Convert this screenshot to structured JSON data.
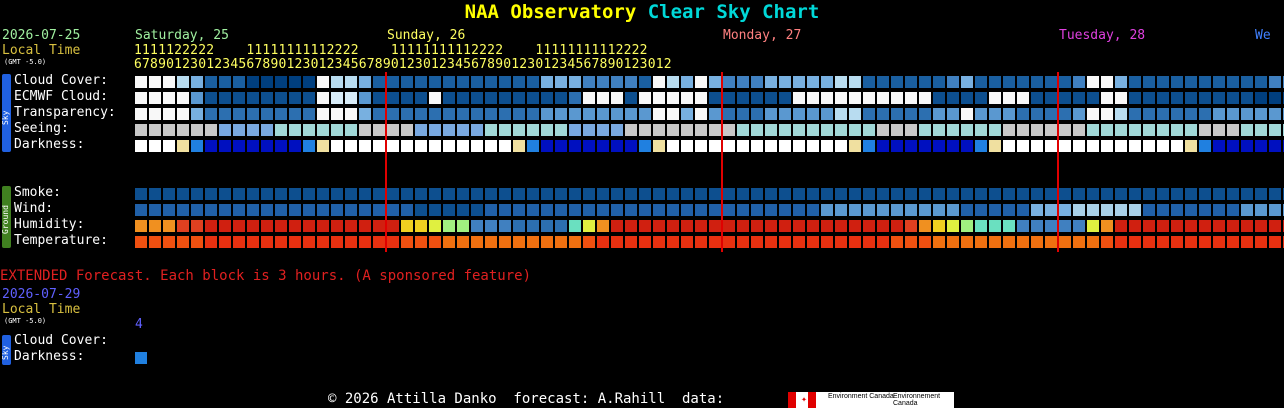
{
  "title_part1": "NAA Observatory",
  "title_part2": "Clear Sky Chart",
  "date": "2026-07-25",
  "local_time_label": "Local Time",
  "gmt_label": "(GMT -5.0)",
  "days": [
    {
      "label": "Saturday, 25",
      "color": "#a0f0a0"
    },
    {
      "label": "Sunday, 26",
      "color": "#ffff60"
    },
    {
      "label": "Monday, 27",
      "color": "#ff8080"
    },
    {
      "label": "Tuesday, 28",
      "color": "#e040e0"
    },
    {
      "label": "We",
      "color": "#4080ff"
    }
  ],
  "hour_row_top": "1111122222    11111111112222    11111111112222    11111111112222",
  "hour_row_bottom": "6789012301234567890123012345678901230123456789012301234567890123012",
  "sky_group_label": "Sky",
  "ground_group_label": "Ground",
  "rows": {
    "cloud": "Cloud Cover:",
    "ecmwf": "ECMWF Cloud:",
    "transparency": "Transparency:",
    "seeing": "Seeing:",
    "darkness": "Darkness:",
    "smoke": "Smoke:",
    "wind": "Wind:",
    "humidity": "Humidity:",
    "temperature": "Temperature:"
  },
  "extended_note": "EXTENDED Forecast. Each block is 3 hours. (A sponsored feature)",
  "ext_date": "2026-07-29",
  "ext_local_time": "Local Time",
  "ext_gmt": "(GMT -5.0)",
  "ext_hour": "4",
  "ext_rows": {
    "cloud": "Cloud Cover:",
    "darkness": "Darkness:"
  },
  "footer_text": "© 2026 Attilla Danko  forecast: A.Rahill  data:",
  "env_canada_en": "Environment Canada",
  "env_canada_fr": "Environnement Canada",
  "colors": {
    "midnight_line": "#e00000",
    "gold_label": "#d8c040",
    "extended_red": "#e02020",
    "sky_tab": "#2060e0",
    "ground_tab": "#408020"
  },
  "chart_data": {
    "type": "heatmap",
    "first_hour": 6,
    "midnight_columns": [
      18,
      42,
      66
    ],
    "cloud_cover": [
      6,
      5,
      5,
      4,
      3,
      1,
      1,
      1,
      0,
      0,
      0,
      0,
      0,
      5,
      4,
      4,
      3,
      1,
      1,
      1,
      1,
      1,
      1,
      1,
      1,
      1,
      1,
      1,
      1,
      3,
      3,
      3,
      2,
      2,
      2,
      2,
      1,
      5,
      4,
      3,
      5,
      3,
      2,
      2,
      2,
      3,
      3,
      3,
      3,
      3,
      4,
      4,
      1,
      1,
      1,
      1,
      1,
      1,
      2,
      3,
      1,
      1,
      1,
      1,
      1,
      1,
      1,
      2,
      5,
      5,
      3,
      1,
      1,
      1,
      1,
      1,
      1,
      1,
      1,
      1,
      1,
      2,
      2,
      1,
      1,
      1,
      1,
      1,
      1,
      1,
      1,
      1,
      1,
      1,
      1,
      1,
      1,
      1,
      1,
      1,
      1,
      1,
      1,
      1,
      1,
      1
    ],
    "ecmwf_cloud": [
      10,
      10,
      10,
      10,
      5,
      1,
      1,
      1,
      1,
      1,
      1,
      1,
      1,
      10,
      9,
      9,
      5,
      1,
      1,
      1,
      1,
      10,
      1,
      1,
      1,
      1,
      1,
      1,
      1,
      1,
      1,
      3,
      10,
      10,
      10,
      1,
      10,
      10,
      10,
      10,
      10,
      1,
      1,
      1,
      1,
      1,
      1,
      10,
      10,
      10,
      10,
      10,
      10,
      10,
      10,
      10,
      10,
      1,
      1,
      1,
      1,
      10,
      10,
      10,
      1,
      1,
      1,
      1,
      1,
      10,
      10,
      1,
      1,
      1,
      1,
      1,
      1,
      1,
      1,
      1,
      0,
      0,
      0,
      0,
      0,
      0,
      0,
      0,
      0,
      0,
      0,
      0,
      0,
      0,
      0,
      0,
      0,
      2,
      2,
      2,
      2,
      2,
      1,
      1,
      1,
      1
    ],
    "transparency": [
      10,
      10,
      10,
      10,
      6,
      3,
      3,
      3,
      3,
      3,
      3,
      3,
      3,
      10,
      10,
      10,
      6,
      3,
      3,
      3,
      3,
      3,
      3,
      3,
      3,
      3,
      3,
      3,
      3,
      5,
      5,
      5,
      5,
      5,
      5,
      5,
      5,
      10,
      10,
      6,
      10,
      5,
      3,
      3,
      3,
      5,
      5,
      5,
      5,
      5,
      8,
      8,
      3,
      3,
      3,
      3,
      3,
      5,
      5,
      10,
      5,
      5,
      5,
      3,
      3,
      3,
      3,
      5,
      10,
      10,
      8,
      3,
      3,
      3,
      3,
      3,
      3,
      5,
      5,
      5,
      5,
      5,
      5,
      5,
      5,
      5,
      3,
      3,
      3,
      3,
      3,
      3,
      3,
      3,
      3,
      3,
      3,
      3,
      3,
      3,
      3,
      5,
      5,
      5,
      5,
      5
    ],
    "seeing": [
      10,
      10,
      10,
      10,
      10,
      10,
      4,
      4,
      4,
      4,
      8,
      8,
      8,
      8,
      8,
      8,
      10,
      10,
      10,
      10,
      4,
      4,
      4,
      4,
      4,
      8,
      8,
      8,
      8,
      8,
      8,
      4,
      4,
      4,
      4,
      10,
      10,
      10,
      10,
      10,
      10,
      10,
      10,
      8,
      8,
      8,
      8,
      8,
      8,
      8,
      8,
      8,
      8,
      10,
      10,
      10,
      8,
      8,
      8,
      8,
      8,
      8,
      10,
      10,
      10,
      10,
      10,
      10,
      8,
      8,
      8,
      8,
      8,
      8,
      8,
      8,
      10,
      10,
      10,
      8,
      8,
      8,
      8,
      8,
      8,
      8,
      8,
      8,
      8,
      8,
      8,
      8,
      8,
      8,
      8,
      8,
      8,
      8,
      8,
      8,
      8,
      8,
      8,
      8,
      8,
      8
    ],
    "darkness": [
      0.0,
      0.0,
      0.0,
      0.2,
      0.6,
      1.0,
      1.0,
      1.0,
      1.0,
      1.0,
      1.0,
      1.0,
      0.6,
      0.2,
      0.0,
      0.0,
      0.0,
      0.0,
      0.0,
      0.0,
      0.0,
      0.0,
      0.0,
      0.0,
      0.0,
      0.0,
      0.0,
      0.2,
      0.6,
      1.0,
      1.0,
      1.0,
      1.0,
      1.0,
      1.0,
      1.0,
      0.6,
      0.2,
      0.0,
      0.0,
      0.0,
      0.0,
      0.0,
      0.0,
      0.0,
      0.0,
      0.0,
      0.0,
      0.0,
      0.0,
      0.0,
      0.2,
      0.6,
      1.0,
      1.0,
      1.0,
      1.0,
      1.0,
      1.0,
      1.0,
      0.6,
      0.2,
      0.0,
      0.0,
      0.0,
      0.0,
      0.0,
      0.0,
      0.0,
      0.0,
      0.0,
      0.0,
      0.0,
      0.0,
      0.0,
      0.2,
      0.6,
      1.0,
      1.0,
      1.0,
      1.0,
      1.0,
      1.0,
      1.0,
      0.6,
      0.2,
      0.0,
      0.0,
      0.0,
      0.0,
      0.0,
      0.0,
      0.0,
      0.0,
      0.0,
      0.0,
      0.0,
      0.0,
      0.0,
      0.2,
      0.6,
      1.0,
      1.0,
      1.0,
      1.0,
      1.0
    ],
    "smoke": [
      0,
      0,
      0,
      0,
      0,
      0,
      0,
      0,
      0,
      0,
      0,
      0,
      0,
      0,
      0,
      0,
      0,
      0,
      0,
      0,
      0,
      0,
      0,
      0,
      0,
      0,
      0,
      0,
      0,
      0,
      0,
      0,
      0,
      0,
      0,
      0,
      0,
      0,
      0,
      0,
      0,
      0,
      0,
      0,
      0,
      0,
      0,
      0,
      0,
      0,
      0,
      0,
      0,
      0,
      0,
      0,
      0,
      0,
      0,
      0,
      0,
      0,
      0,
      0,
      0,
      0,
      0,
      0,
      0,
      0,
      0,
      0,
      0,
      0,
      0,
      0,
      0,
      0,
      0,
      0,
      0,
      0,
      0,
      0,
      0,
      0,
      0,
      0,
      0
    ],
    "wind": [
      2,
      2,
      2,
      2,
      2,
      2,
      2,
      2,
      2,
      2,
      2,
      2,
      2,
      2,
      2,
      2,
      2,
      2,
      2,
      2,
      1,
      1,
      1,
      1,
      1,
      2,
      2,
      2,
      2,
      2,
      2,
      2,
      2,
      2,
      2,
      2,
      2,
      2,
      2,
      2,
      2,
      2,
      2,
      2,
      2,
      2,
      2,
      2,
      2,
      3,
      3,
      3,
      3,
      3,
      3,
      3,
      3,
      3,
      3,
      2,
      2,
      2,
      2,
      2,
      4,
      4,
      4,
      5,
      5,
      5,
      5,
      5,
      2,
      2,
      2,
      2,
      2,
      2,
      2,
      3,
      3,
      3,
      3,
      3,
      3,
      4,
      4,
      5,
      5,
      5,
      5,
      4,
      4,
      4,
      4,
      4,
      4,
      4,
      4,
      4,
      4,
      4,
      4,
      4,
      4,
      4
    ],
    "humidity": [
      8,
      8,
      8,
      9,
      9,
      10,
      10,
      10,
      10,
      10,
      10,
      10,
      10,
      10,
      10,
      10,
      10,
      10,
      10,
      7,
      7,
      6,
      5,
      5,
      3,
      3,
      3,
      2,
      2,
      2,
      2,
      4,
      6,
      8,
      10,
      10,
      10,
      10,
      10,
      10,
      10,
      10,
      10,
      10,
      10,
      10,
      10,
      10,
      10,
      10,
      10,
      10,
      10,
      10,
      10,
      9,
      8,
      7,
      6,
      5,
      4,
      4,
      4,
      3,
      3,
      3,
      3,
      3,
      6,
      8,
      10,
      10,
      10,
      10,
      10,
      10,
      10,
      10,
      10,
      10,
      10,
      10,
      10,
      9,
      8,
      7,
      7,
      6,
      5,
      4,
      4,
      4,
      4,
      4,
      4,
      4,
      4,
      4,
      4,
      4,
      4,
      4,
      4,
      5,
      6,
      6
    ],
    "temperature": [
      9,
      9,
      9,
      9,
      9,
      10,
      10,
      10,
      10,
      10,
      10,
      10,
      10,
      10,
      10,
      10,
      10,
      10,
      10,
      9,
      9,
      9,
      8,
      8,
      8,
      8,
      8,
      8,
      8,
      8,
      8,
      8,
      9,
      10,
      10,
      10,
      10,
      10,
      10,
      10,
      10,
      10,
      10,
      10,
      10,
      10,
      10,
      10,
      10,
      10,
      10,
      10,
      10,
      10,
      9,
      9,
      9,
      8,
      8,
      8,
      8,
      8,
      8,
      8,
      8,
      8,
      8,
      8,
      8,
      9,
      10,
      10,
      10,
      10,
      10,
      10,
      10,
      10,
      10,
      10,
      10,
      10,
      10,
      9,
      9,
      9,
      9,
      9,
      8,
      8,
      8,
      8,
      8,
      8,
      8,
      8,
      8,
      8,
      9,
      9,
      9,
      9,
      9,
      9,
      8,
      7
    ],
    "extended_darkness": [
      0.5
    ]
  }
}
